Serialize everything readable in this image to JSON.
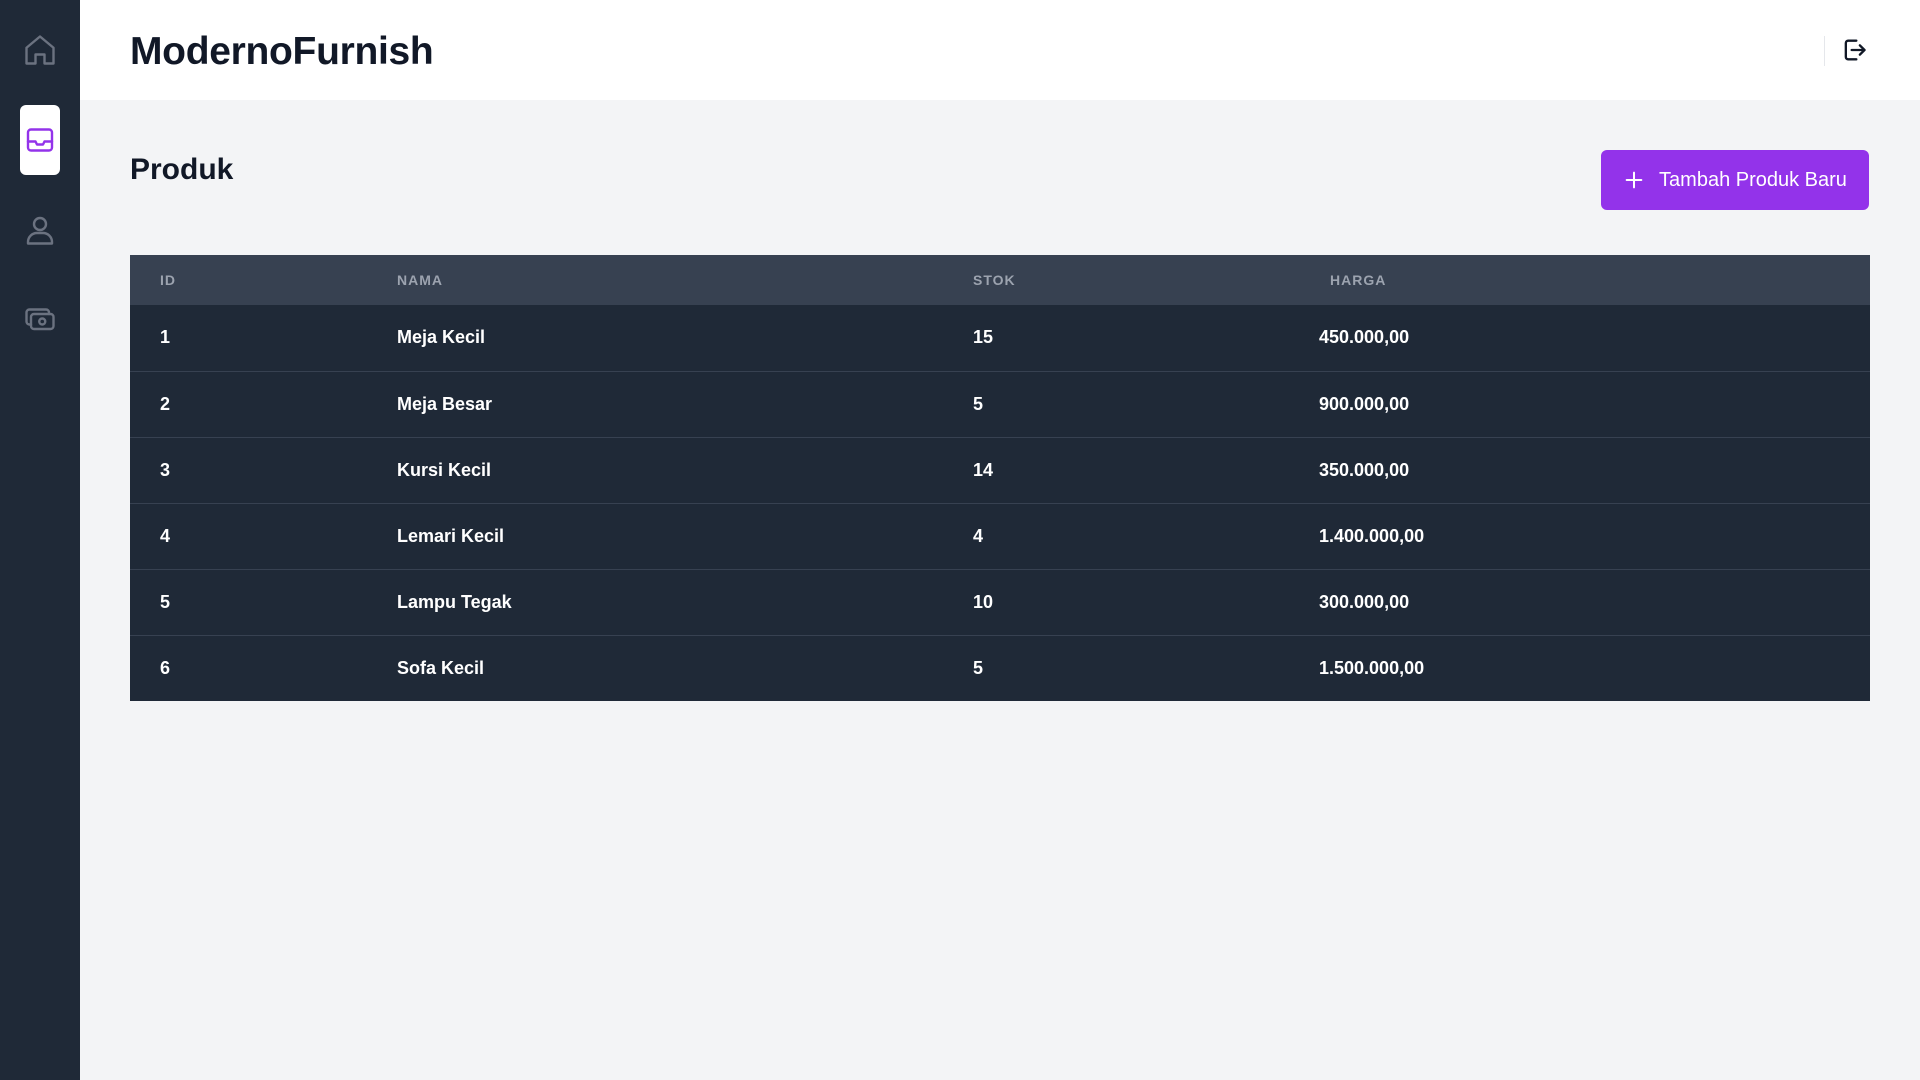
{
  "app": {
    "title": "ModernoFurnish"
  },
  "sidebar": {
    "items": [
      {
        "icon": "home-icon",
        "active": false
      },
      {
        "icon": "inbox-tray-icon",
        "active": true
      },
      {
        "icon": "user-icon",
        "active": false
      },
      {
        "icon": "cash-icon",
        "active": false
      }
    ]
  },
  "header": {
    "logout_icon": "logout-icon"
  },
  "page": {
    "title": "Produk",
    "add_button_label": "Tambah Produk Baru"
  },
  "table": {
    "columns": [
      "ID",
      "NAMA",
      "STOK",
      "HARGA"
    ],
    "rows": [
      {
        "id": "1",
        "nama": "Meja Kecil",
        "stok": "15",
        "harga": "450.000,00"
      },
      {
        "id": "2",
        "nama": "Meja Besar",
        "stok": "5",
        "harga": "900.000,00"
      },
      {
        "id": "3",
        "nama": "Kursi Kecil",
        "stok": "14",
        "harga": "350.000,00"
      },
      {
        "id": "4",
        "nama": "Lemari Kecil",
        "stok": "4",
        "harga": "1.400.000,00"
      },
      {
        "id": "5",
        "nama": "Lampu Tegak",
        "stok": "10",
        "harga": "300.000,00"
      },
      {
        "id": "6",
        "nama": "Sofa Kecil",
        "stok": "5",
        "harga": "1.500.000,00"
      }
    ]
  },
  "colors": {
    "sidebar_bg": "#1f2937",
    "accent": "#9333ea",
    "table_bg": "#1f2937",
    "table_header_bg": "#374151",
    "page_bg": "#f3f4f6"
  }
}
